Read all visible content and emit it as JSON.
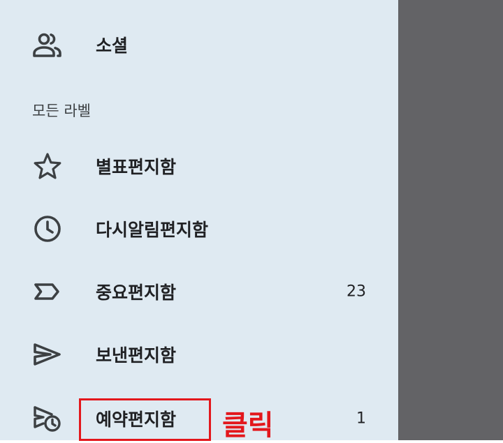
{
  "drawer": {
    "items_top": [
      {
        "label": "소셜",
        "icon": "people-icon"
      }
    ],
    "section_header": "모든 라벨",
    "items": [
      {
        "label": "별표편지함",
        "icon": "star-icon",
        "count": ""
      },
      {
        "label": "다시알림편지함",
        "icon": "clock-icon",
        "count": ""
      },
      {
        "label": "중요편지함",
        "icon": "label-important-icon",
        "count": "23"
      },
      {
        "label": "보낸편지함",
        "icon": "send-icon",
        "count": ""
      },
      {
        "label": "예약편지함",
        "icon": "schedule-send-icon",
        "count": "1"
      }
    ]
  },
  "annotation": {
    "text": "클릭",
    "color": "#e3171c"
  },
  "colors": {
    "drawer_bg": "#dfeaf2",
    "scrim": "#636366",
    "text": "#202124",
    "icon": "#3c4043"
  }
}
